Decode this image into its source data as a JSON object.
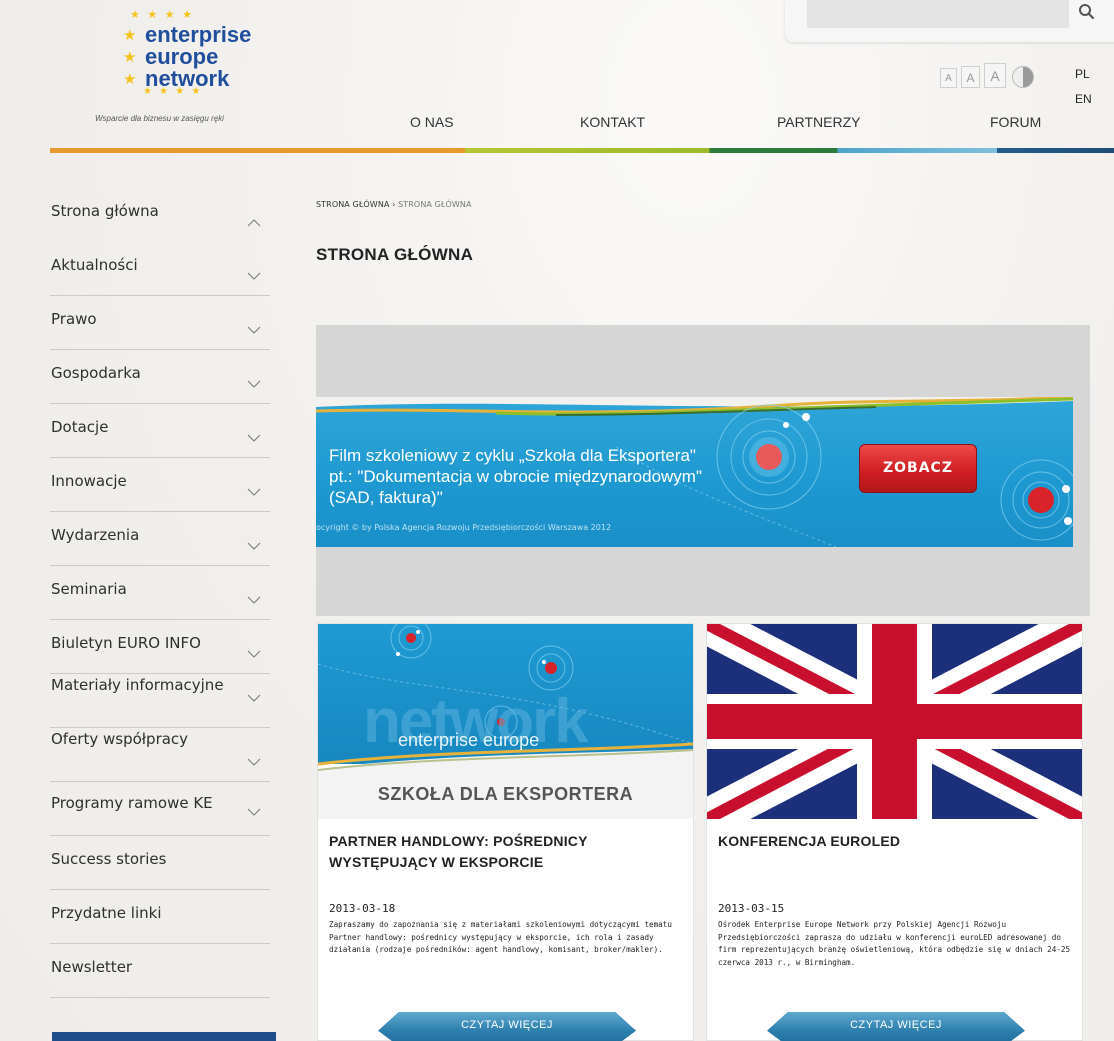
{
  "logo": {
    "line1": "enterprise",
    "line2": "europe",
    "line3": "network",
    "tagline": "Wsparcie dla biznesu w zasięgu ręki"
  },
  "header": {
    "search_icon": "search-icon",
    "font_sizes": [
      "A",
      "A",
      "A"
    ],
    "languages": [
      "PL",
      "EN"
    ]
  },
  "nav": {
    "items": [
      "O NAS",
      "KONTAKT",
      "PARTNERZY",
      "FORUM"
    ]
  },
  "sidebar": {
    "items": [
      {
        "label": "Strona główna",
        "state": "expanded"
      },
      {
        "label": "Aktualności",
        "state": "collapsed"
      },
      {
        "label": "Prawo",
        "state": "collapsed"
      },
      {
        "label": "Gospodarka",
        "state": "collapsed"
      },
      {
        "label": "Dotacje",
        "state": "collapsed"
      },
      {
        "label": "Innowacje",
        "state": "collapsed"
      },
      {
        "label": "Wydarzenia",
        "state": "collapsed"
      },
      {
        "label": "Seminaria",
        "state": "collapsed"
      },
      {
        "label": "Biuletyn EURO INFO",
        "state": "collapsed"
      },
      {
        "label": "Materiały informacyjne",
        "state": "collapsed"
      },
      {
        "label": "Oferty współpracy",
        "state": "collapsed"
      },
      {
        "label": "Programy ramowe KE",
        "state": "collapsed"
      },
      {
        "label": "Success stories",
        "state": "none"
      },
      {
        "label": "Przydatne linki",
        "state": "none"
      },
      {
        "label": "Newsletter",
        "state": "none"
      }
    ]
  },
  "breadcrumb": {
    "root": "STRONA GŁÓWNA",
    "separator": "›",
    "current": "STRONA GŁÓWNA"
  },
  "page_title": "STRONA GŁÓWNA",
  "banner": {
    "text_line1": "Film szkoleniowy z cyklu „Szkoła dla Eksportera\"",
    "text_line2": "pt.: \"Dokumentacja w obrocie międzynarodowym\"",
    "text_line3": "(SAD, faktura)\"",
    "copyright": "ocyright © by Polska Agencja Rozwoju Przedsiębiorczości Warszawa 2012",
    "button_label": "ZOBACZ"
  },
  "cards": [
    {
      "image_caption_big": "network",
      "image_caption_small": "enterprise europe",
      "image_caption": "SZKOŁA DLA EKSPORTERA",
      "title": "PARTNER HANDLOWY: POŚREDNICY WYSTĘPUJĄCY W EKSPORCIE",
      "date": "2013-03-18",
      "description": "Zapraszamy do zapoznania się z materiałami szkoleniowymi dotyczącymi tematu Partner handlowy: pośrednicy występujący w eksporcie, ich rola i zasady działania (rodzaje pośredników: agent handlowy, komisant, broker/makler).",
      "button_label": "CZYTAJ WIĘCEJ"
    },
    {
      "title": "KONFERENCJA EUROLED",
      "date": "2013-03-15",
      "description": "Ośrodek Enterprise Europe Network przy Polskiej Agencji Rozwoju Przedsiębiorczości zaprasza do udziału w konferencji euroLED adresowanej do firm reprezentujących branżę oświetleniową, która odbędzie się w dniach 24-25 czerwca 2013 r., w Birmingham.",
      "button_label": "CZYTAJ WIĘCEJ"
    }
  ],
  "colors": {
    "brand_blue": "#1f4e9c",
    "banner_blue": "#1e98d1",
    "zobacz_red": "#d11f24",
    "button_blue": "#2d7fae"
  }
}
